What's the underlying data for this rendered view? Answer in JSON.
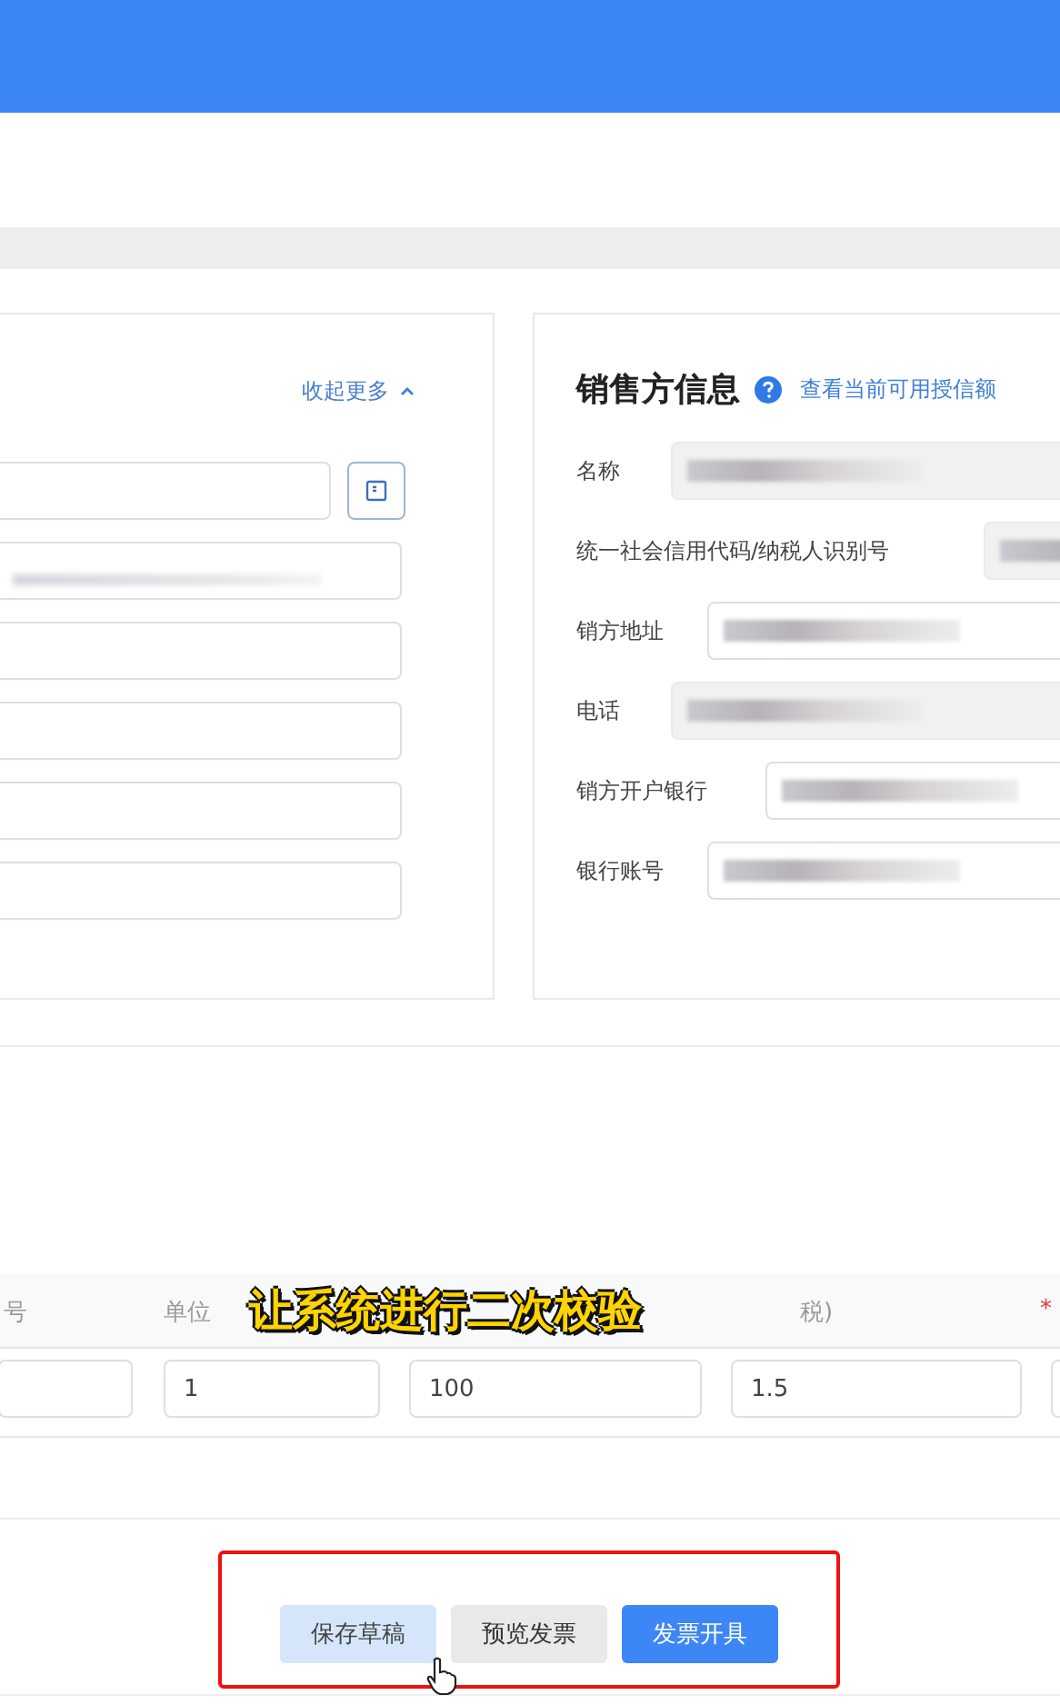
{
  "left_panel": {
    "collapse_link": "收起更多",
    "fields": [
      {
        "kind": "input_with_button",
        "filled": false
      },
      {
        "kind": "input",
        "filled": true
      },
      {
        "kind": "input",
        "filled": false
      },
      {
        "kind": "input",
        "filled": false
      },
      {
        "kind": "input",
        "filled": false
      },
      {
        "kind": "input",
        "filled": false
      }
    ]
  },
  "seller_panel": {
    "title": "销售方信息",
    "quota_link": "查看当前可用授信额",
    "fields": [
      {
        "label": "名称",
        "disabled": true,
        "filled": true
      },
      {
        "label": "统一社会信用代码/纳税人识别号",
        "disabled": true,
        "filled": true
      },
      {
        "label": "销方地址",
        "disabled": false,
        "filled": true
      },
      {
        "label": "电话",
        "disabled": true,
        "filled": true
      },
      {
        "label": "销方开户银行",
        "disabled": false,
        "filled": true
      },
      {
        "label": "银行账号",
        "disabled": false,
        "filled": true
      }
    ]
  },
  "item_table": {
    "columns": [
      {
        "header": "号"
      },
      {
        "header": "单位",
        "value": "1"
      },
      {
        "value": "100"
      },
      {
        "header": "税)",
        "value": "1.5"
      },
      {
        "header": "*",
        "required": true
      }
    ]
  },
  "caption": "让系统进行二次校验",
  "actions": [
    {
      "label": "保存草稿",
      "kind": "secondary"
    },
    {
      "label": "预览发票",
      "kind": "default"
    },
    {
      "label": "发票开具",
      "kind": "primary"
    }
  ]
}
